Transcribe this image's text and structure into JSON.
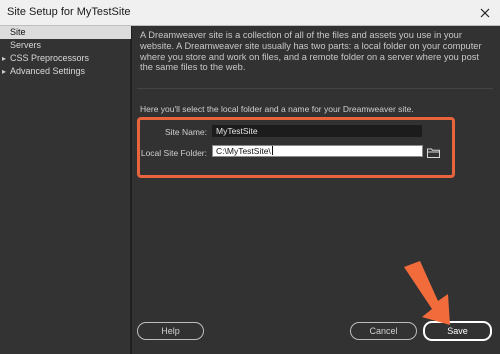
{
  "window": {
    "title": "Site Setup for MyTestSite"
  },
  "sidebar": {
    "items": [
      {
        "label": "Site",
        "selected": true,
        "expandable": false
      },
      {
        "label": "Servers",
        "selected": false,
        "expandable": false
      },
      {
        "label": "CSS Preprocessors",
        "selected": false,
        "expandable": true
      },
      {
        "label": "Advanced Settings",
        "selected": false,
        "expandable": true
      }
    ]
  },
  "main": {
    "description": "A Dreamweaver site is a collection of all of the files and assets you use in your website. A Dreamweaver site usually has two parts: a local folder on your computer where you store and work on files, and a remote folder on a server where you post the same files to the web.",
    "instruction": "Here you'll select the local folder and a name for your Dreamweaver site.",
    "site_name_label": "Site Name:",
    "site_name_value": "MyTestSite",
    "local_folder_label": "Local Site Folder:",
    "local_folder_value": "C:\\MyTestSite\\"
  },
  "footer": {
    "help_label": "Help",
    "cancel_label": "Cancel",
    "save_label": "Save"
  },
  "colors": {
    "highlight": "#e8643c",
    "arrow": "#f26b3a"
  }
}
